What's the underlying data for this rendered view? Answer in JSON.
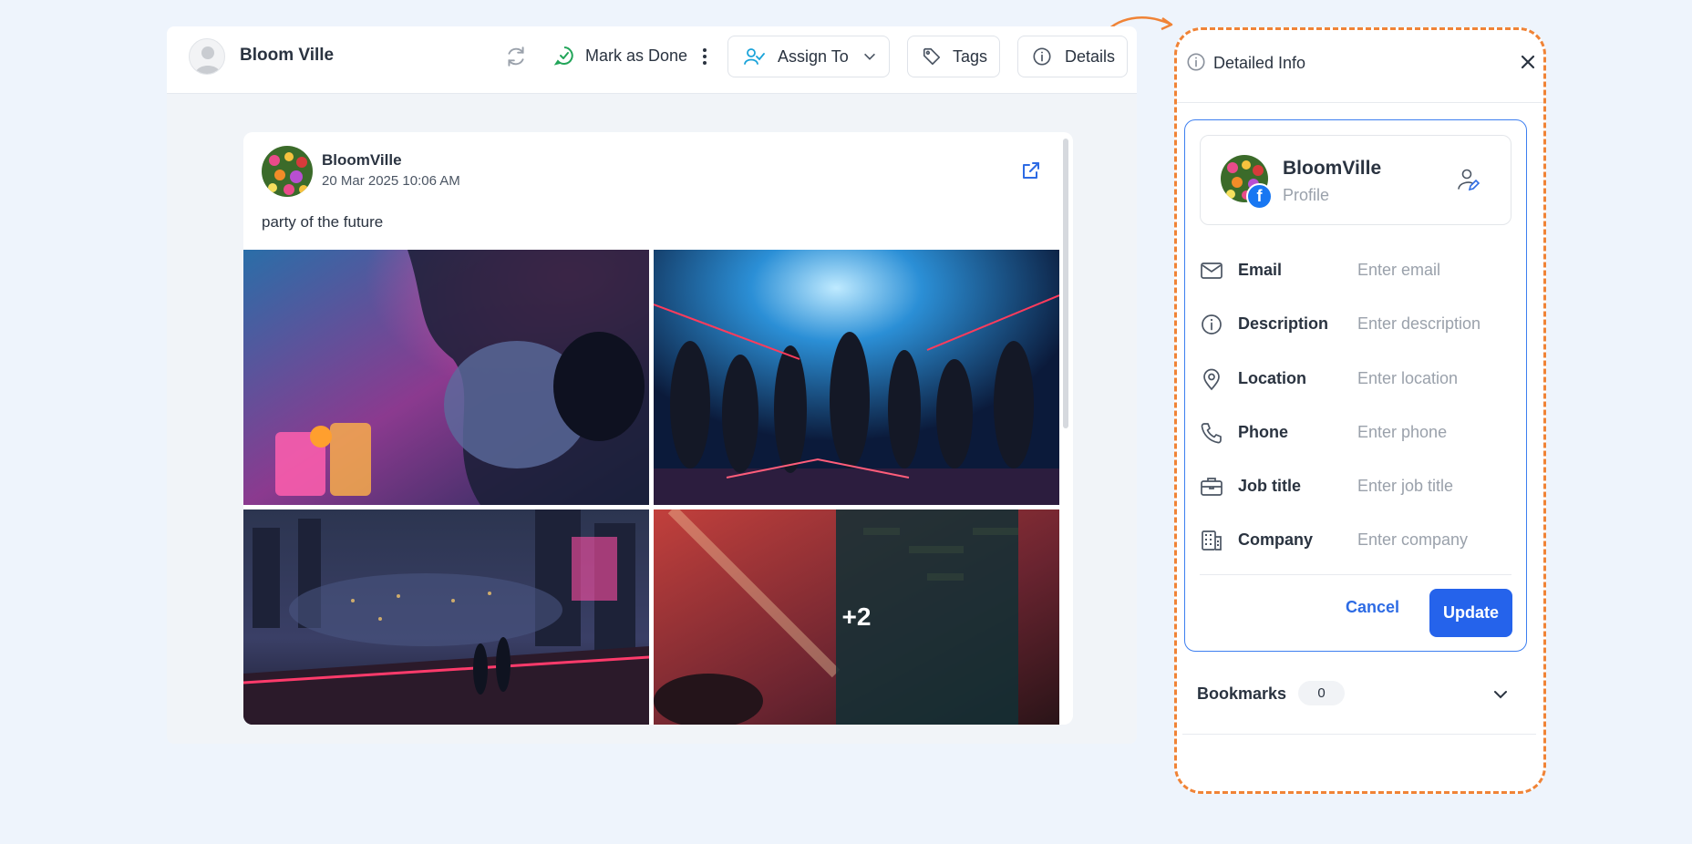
{
  "header": {
    "contact_name": "Bloom Ville",
    "mark_done_label": "Mark as Done",
    "assign_label": "Assign To",
    "tags_label": "Tags",
    "details_label": "Details"
  },
  "post": {
    "author": "BloomVille",
    "timestamp": "20 Mar 2025 10:06 AM",
    "text": "party of the future",
    "extra_images": "+2"
  },
  "panel": {
    "title": "Detailed Info",
    "profile_name": "BloomVille",
    "profile_subtitle": "Profile",
    "fields": [
      {
        "label": "Email",
        "placeholder": "Enter email",
        "icon": "mail-icon"
      },
      {
        "label": "Description",
        "placeholder": "Enter description",
        "icon": "info-icon"
      },
      {
        "label": "Location",
        "placeholder": "Enter location",
        "icon": "location-pin-icon"
      },
      {
        "label": "Phone",
        "placeholder": "Enter phone",
        "icon": "phone-icon"
      },
      {
        "label": "Job title",
        "placeholder": "Enter job title",
        "icon": "briefcase-icon"
      },
      {
        "label": "Company",
        "placeholder": "Enter company",
        "icon": "building-icon"
      }
    ],
    "cancel_label": "Cancel",
    "update_label": "Update",
    "bookmarks_label": "Bookmarks",
    "bookmarks_count": "0"
  },
  "colors": {
    "accent": "#2563eb",
    "done_green": "#22a559",
    "assign_icon": "#1aa3d9",
    "highlight_dash": "#f08336",
    "facebook": "#1877f2"
  }
}
